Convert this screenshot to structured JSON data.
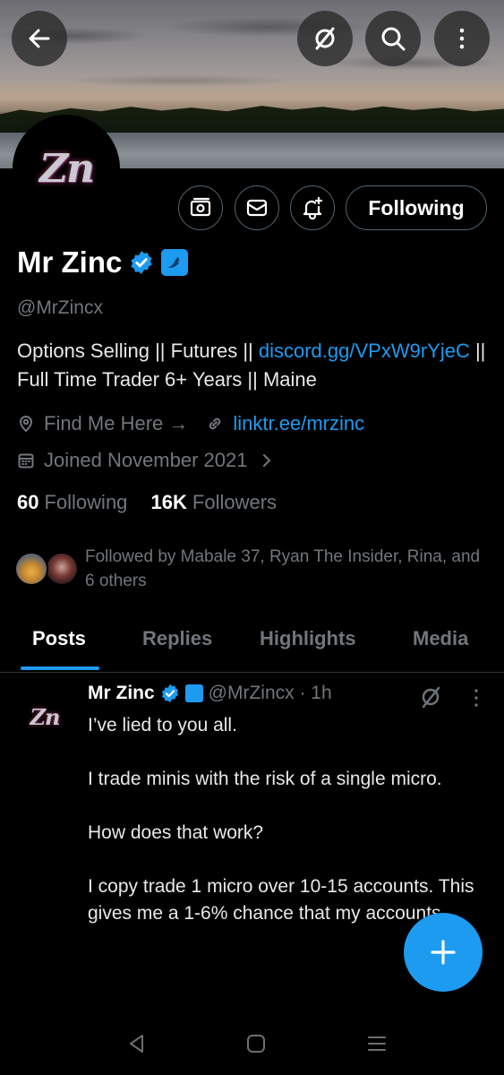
{
  "header": {
    "back_icon": "arrow-left-icon",
    "grok_icon": "grok-icon",
    "search_icon": "search-icon",
    "more_icon": "more-vertical-icon"
  },
  "profile": {
    "avatar_text": "Zn",
    "name": "Mr Zinc",
    "handle": "@MrZincx",
    "follow_label": "Following",
    "bio_part1": "Options Selling || Futures || ",
    "bio_link": "discord.gg/​VPxW9rYjeC",
    "bio_part2": " || Full Time Trader 6+ Years || Maine",
    "location": "Find Me Here →",
    "website": "linktr.ee/mrzinc",
    "joined": "Joined November 2021",
    "following_count": "60",
    "following_label": "Following",
    "followers_count": "16K",
    "followers_label": "Followers",
    "followed_by": "Followed by Mabale 37, Ryan The Insider, Rina, and 6 others"
  },
  "tabs": [
    {
      "label": "Posts",
      "active": true
    },
    {
      "label": "Replies",
      "active": false
    },
    {
      "label": "Highlights",
      "active": false
    },
    {
      "label": "Media",
      "active": false
    }
  ],
  "post": {
    "avatar_text": "Zn",
    "name": "Mr Zinc",
    "handle_time": "@MrZincx · 1h",
    "body": "I’ve lied to you all.\n\nI trade minis with the risk of a single micro.\n\nHow does that work?\n\nI copy trade 1 micro over 10-15 accounts. This gives me a 1-6% chance that my accounts."
  },
  "colors": {
    "accent": "#1d9bf0",
    "muted": "#71767b",
    "background": "#000000"
  }
}
